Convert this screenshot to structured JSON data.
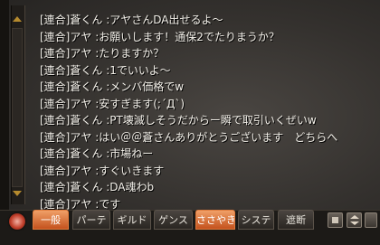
{
  "chat": {
    "messages": [
      {
        "channel": "[連合]",
        "speaker": "蒼くん",
        "sep": " :",
        "text": "アヤさんDA出せるよ～"
      },
      {
        "channel": "[連合]",
        "speaker": "アヤ",
        "sep": " :",
        "text": "お願いします！通保2でたりまうか？"
      },
      {
        "channel": "[連合]",
        "speaker": "アヤ",
        "sep": " :",
        "text": "たりますか？"
      },
      {
        "channel": "[連合]",
        "speaker": "蒼くん",
        "sep": " :",
        "text": "1でいいよ～"
      },
      {
        "channel": "[連合]",
        "speaker": "蒼くん",
        "sep": " :",
        "text": "メンバ価格でw"
      },
      {
        "channel": "[連合]",
        "speaker": "アヤ",
        "sep": " :",
        "text": "安すぎます(;´Д`)"
      },
      {
        "channel": "[連合]",
        "speaker": "蒼くん",
        "sep": " :",
        "text": "PT壊滅しそうだからー瞬で取引いくぜいw"
      },
      {
        "channel": "[連合]",
        "speaker": "アヤ",
        "sep": " :",
        "text": "はい＠＠蒼さんありがとうございます　どちらへ"
      },
      {
        "channel": "[連合]",
        "speaker": "蒼くん",
        "sep": " :",
        "text": "市場ねー"
      },
      {
        "channel": "[連合]",
        "speaker": "アヤ",
        "sep": " :",
        "text": "すぐいきます"
      },
      {
        "channel": "[連合]",
        "speaker": "蒼くん",
        "sep": " :",
        "text": "DA魂わb"
      },
      {
        "channel": "[連合]",
        "speaker": "アヤ",
        "sep": " :",
        "text": "です"
      }
    ]
  },
  "tabs": [
    {
      "label": "一般",
      "active": true
    },
    {
      "label": "パーテ",
      "active": false
    },
    {
      "label": "ギルド",
      "active": false
    },
    {
      "label": "ゲンス",
      "active": false
    },
    {
      "label": "ささやき",
      "active": true
    },
    {
      "label": "システ",
      "active": false
    },
    {
      "label": "遮断",
      "active": false
    }
  ],
  "colors": {
    "text": "#f4f1ea",
    "accent": "#e07b3c",
    "gold": "#b58a2e"
  },
  "icons": {
    "settings": "gear-icon",
    "scroll_up": "scroll-up-arrow-icon",
    "scroll_down": "scroll-down-arrow-icon",
    "square": "square-icon",
    "expand": "up-down-arrows-icon"
  }
}
